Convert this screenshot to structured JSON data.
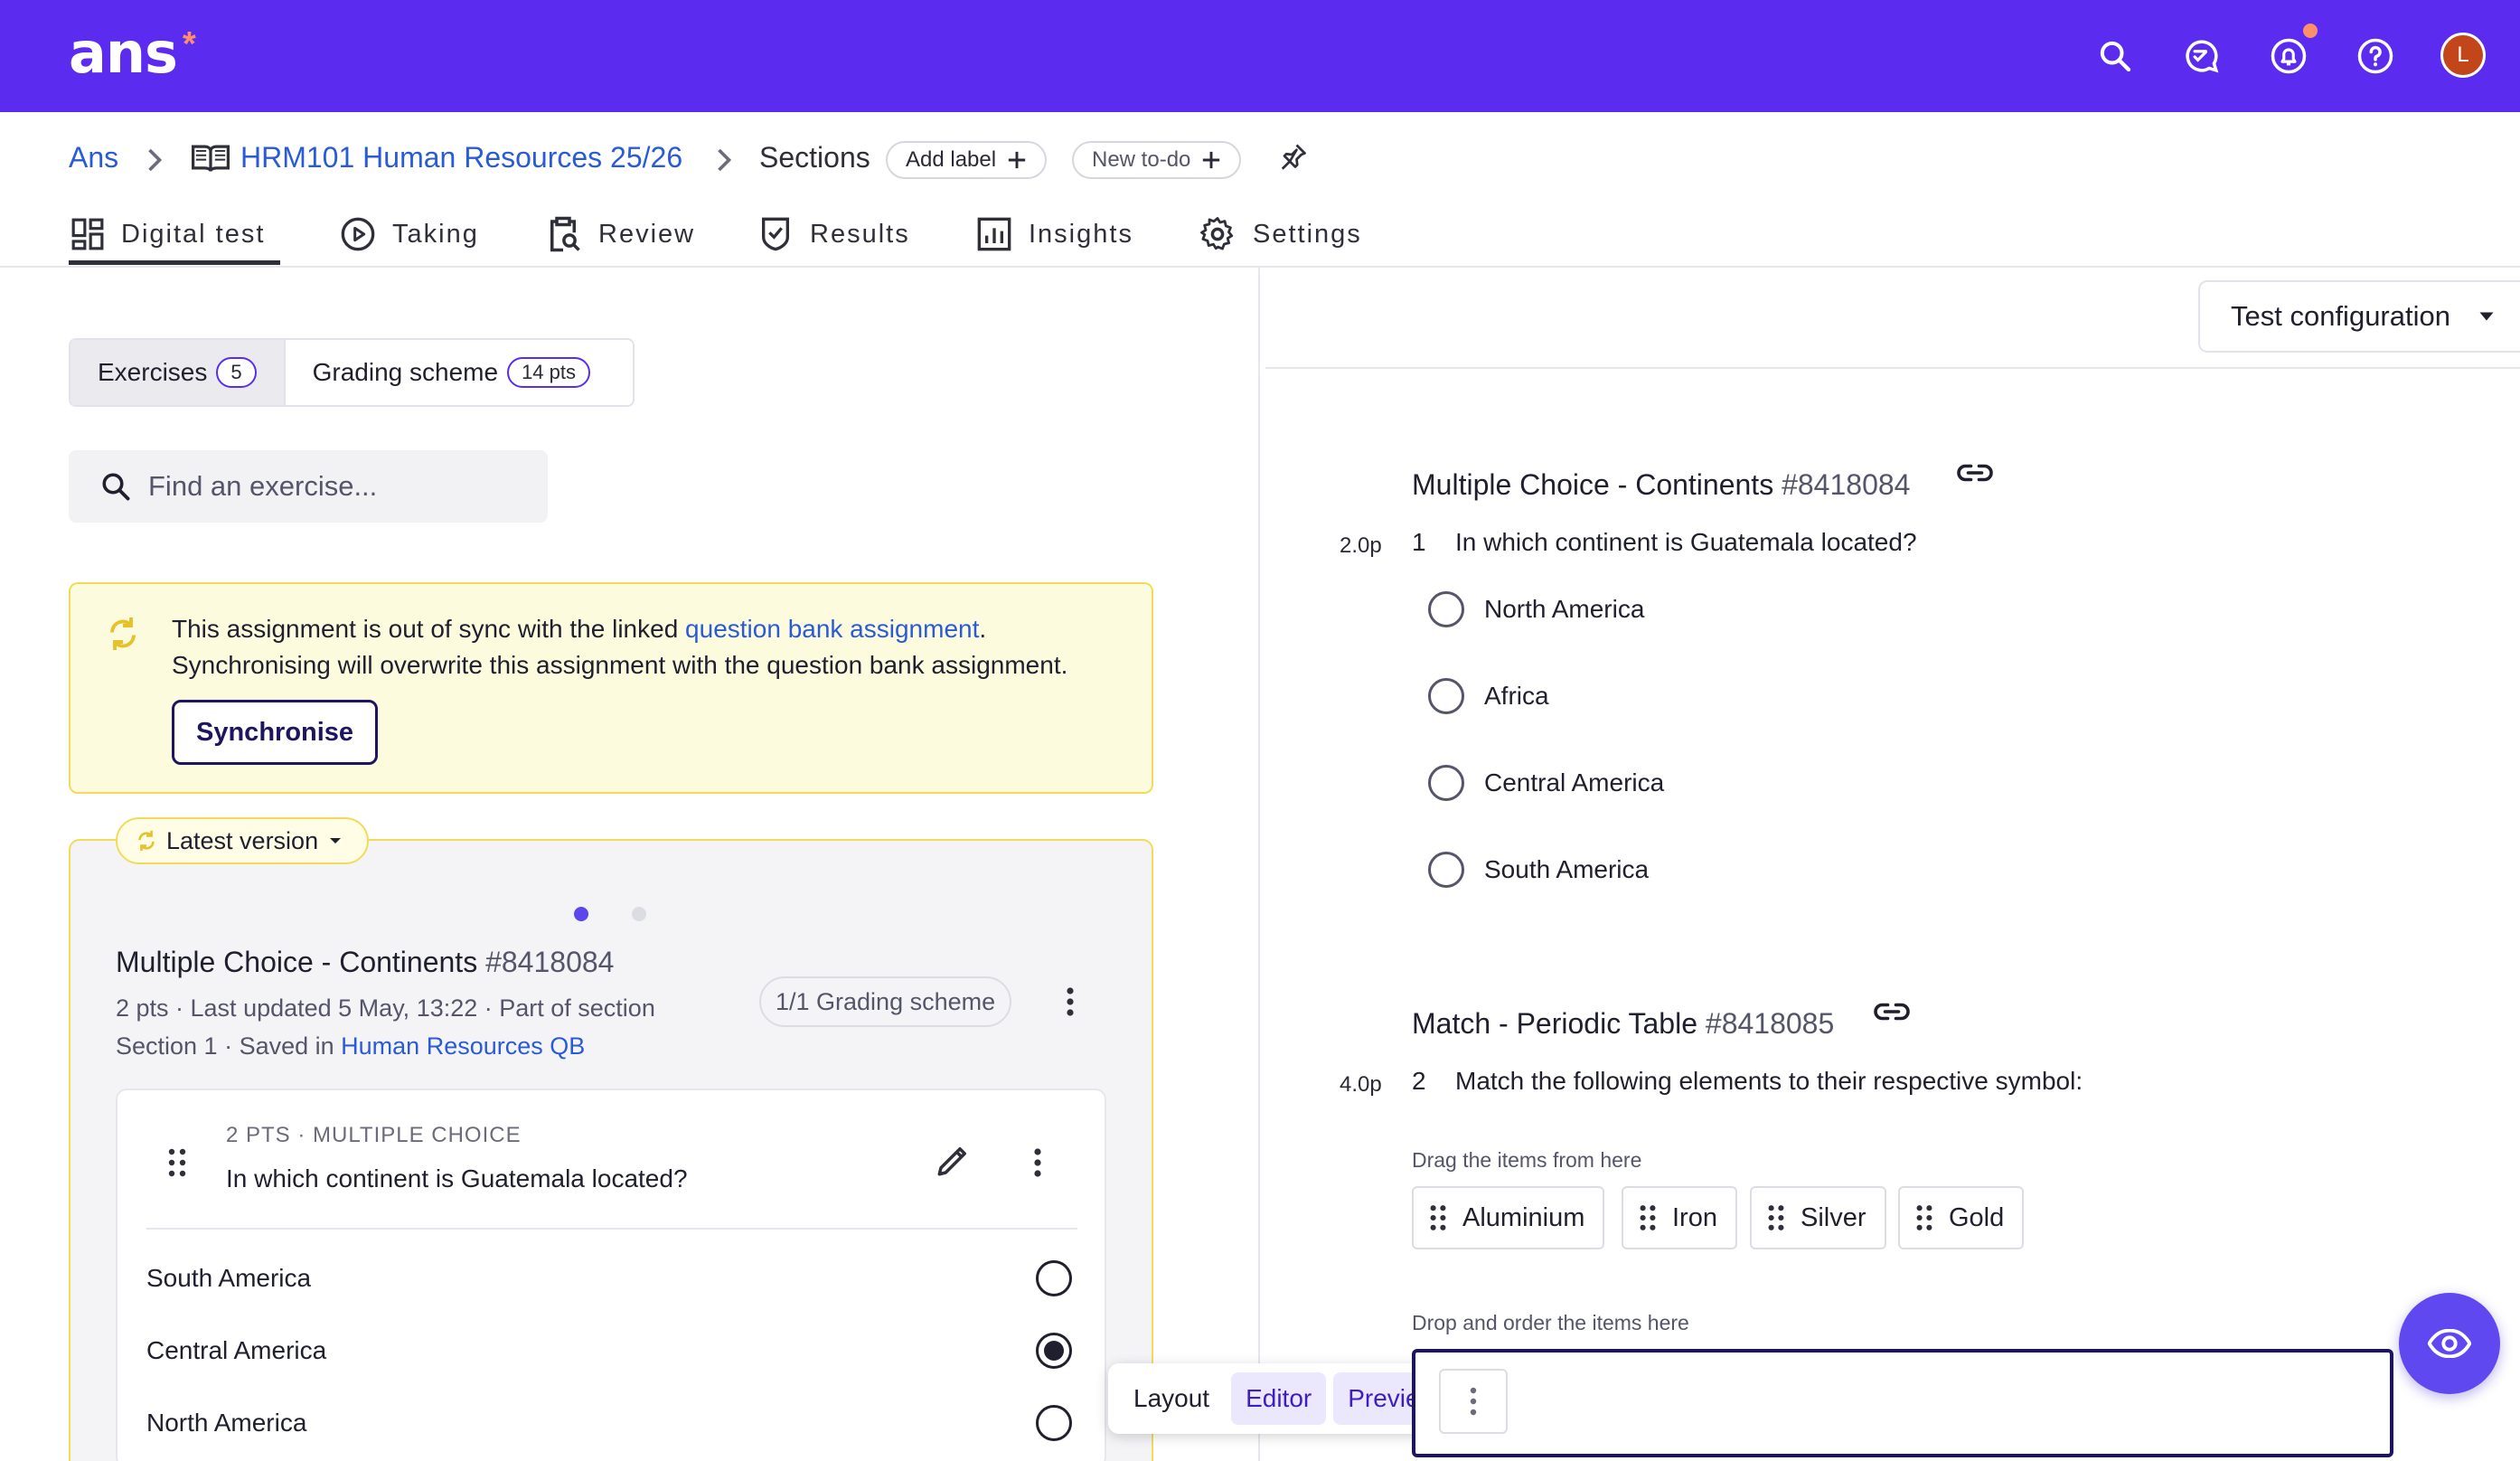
{
  "app": {
    "logo": "ans",
    "logo_star": "*",
    "avatar_initial": "L"
  },
  "colors": {
    "brand": "#5b2bf0",
    "warning_bg": "#fcfbde",
    "warning_border": "#f1dc59",
    "link": "#2a5bd7",
    "notification": "#ff8f6b"
  },
  "topbar_icons": [
    "search-icon",
    "chat-check-icon",
    "bell-icon",
    "help-icon",
    "avatar"
  ],
  "breadcrumb": {
    "root": "Ans",
    "course": "HRM101 Human Resources 25/26",
    "current": "Sections",
    "add_label": "Add label",
    "new_todo": "New to-do"
  },
  "tabs": [
    {
      "label": "Digital test",
      "icon": "dashboard-icon",
      "active": true
    },
    {
      "label": "Taking",
      "icon": "play-circle-icon"
    },
    {
      "label": "Review",
      "icon": "clipboard-search-icon"
    },
    {
      "label": "Results",
      "icon": "shield-check-icon"
    },
    {
      "label": "Insights",
      "icon": "bar-chart-icon"
    },
    {
      "label": "Settings",
      "icon": "gear-icon"
    }
  ],
  "left": {
    "segment": {
      "exercises_label": "Exercises",
      "exercises_count": "5",
      "grading_label": "Grading scheme",
      "grading_pts": "14 pts"
    },
    "search_placeholder": "Find an exercise...",
    "warning": {
      "text_before": "This assignment is out of sync with the linked ",
      "link": "question bank assignment",
      "text_after": ".",
      "line2": "Synchronising will overwrite this assignment with the question bank assignment.",
      "button": "Synchronise"
    },
    "version_label": "Latest version",
    "exercise": {
      "title": "Multiple Choice - Continents",
      "id": "#8418084",
      "meta_line1": "2 pts · Last updated 5 May, 13:22 · Part of section",
      "meta_line2_prefix": "Section 1 · Saved in ",
      "meta_line2_link": "Human Resources QB",
      "grading_pill": "1/1 Grading scheme",
      "question": {
        "meta": "2 PTS · MULTIPLE CHOICE",
        "text": "In which continent is Guatemala located?",
        "answers": [
          {
            "label": "South America",
            "selected": false
          },
          {
            "label": "Central America",
            "selected": true
          },
          {
            "label": "North America",
            "selected": false
          }
        ]
      }
    },
    "modebar": {
      "layout": "Layout",
      "editor": "Editor",
      "preview": "Preview"
    }
  },
  "right": {
    "config_label": "Test configuration",
    "q1": {
      "title": "Multiple Choice - Continents",
      "id": "#8418084",
      "points": "2.0p",
      "number": "1",
      "text": "In which continent is Guatemala located?",
      "options": [
        "North America",
        "Africa",
        "Central America",
        "South America"
      ]
    },
    "q2": {
      "title": "Match - Periodic Table",
      "id": "#8418085",
      "points": "4.0p",
      "number": "2",
      "text": "Match the following elements to their respective symbol:",
      "drag_label": "Drag the items from here",
      "items": [
        "Aluminium",
        "Iron",
        "Silver",
        "Gold"
      ],
      "drop_label": "Drop and order the items here"
    }
  }
}
